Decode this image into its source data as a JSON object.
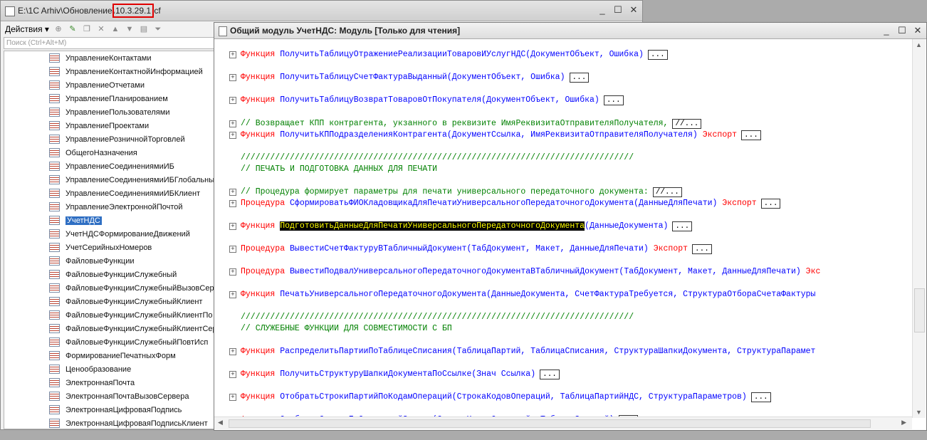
{
  "back_window": {
    "title_prefix": "E:\\1C Arhiv\\Обновление\\",
    "title_version": "10.3.29.1",
    "title_suffix": ".cf",
    "minimize": "_",
    "maximize": "☐",
    "close": "✕",
    "actions_label": "Действия ▾",
    "search_placeholder": "Поиск (Ctrl+Alt+M)",
    "tree_items": [
      "УправлениеКонтактами",
      "УправлениеКонтактнойИнформацией",
      "УправлениеОтчетами",
      "УправлениеПланированием",
      "УправлениеПользователями",
      "УправлениеПроектами",
      "УправлениеРозничнойТорговлей",
      "ОбщегоНазначения",
      "УправлениеСоединениямиИБ",
      "УправлениеСоединениямиИБГлобальный",
      "УправлениеСоединениямиИБКлиент",
      "УправлениеЭлектроннойПочтой",
      "УчетНДС",
      "УчетНДСФормированиеДвижений",
      "УчетСерийныхНомеров",
      "ФайловыеФункции",
      "ФайловыеФункцииСлужебный",
      "ФайловыеФункцииСлужебныйВызовСервера",
      "ФайловыеФункцииСлужебныйКлиент",
      "ФайловыеФункцииСлужебныйКлиентПо",
      "ФайловыеФункцииСлужебныйКлиентСервер",
      "ФайловыеФункцииСлужебныйПовтИсп",
      "ФормированиеПечатныхФорм",
      "Ценообразование",
      "ЭлектроннаяПочта",
      "ЭлектроннаяПочтаВызовСервера",
      "ЭлектроннаяЦифроваяПодпись",
      "ЭлектроннаяЦифроваяПодписьКлиент"
    ],
    "selected_item": "УчетНДС"
  },
  "module_window": {
    "title": "Общий модуль УчетНДС: Модуль [Только для чтения]",
    "minimize": "_",
    "maximize": "☐",
    "close": "✕",
    "lines": [
      {
        "kw": "Функция",
        "name": "ПолучитьТаблицуОтражениеРеализацииТоваровИУслугНДС",
        "args": "(ДокументОбъект, Ошибка)",
        "tail": "",
        "dots": "..."
      },
      {
        "kw": "Функция",
        "name": "ПолучитьТаблицуСчетФактураВыданный",
        "args": "(ДокументОбъект, Ошибка)",
        "tail": "",
        "dots": "..."
      },
      {
        "kw": "Функция",
        "name": "ПолучитьТаблицуВозвратТоваровОтПокупателя",
        "args": "(ДокументОбъект, Ошибка)",
        "tail": "",
        "dots": "..."
      },
      {
        "comment": "//  Возвращает КПП контрагента, укзанного в реквизите ИмяРеквизитаОтправителяПолучателя,",
        "dots": "//..."
      },
      {
        "kw": "Функция",
        "name": "ПолучитьКППодразделенияКонтрагента",
        "args": "(ДокументСсылка, ИмяРеквизитаОтправителяПолучателя)",
        "tail": " Экспорт",
        "dots": "..."
      },
      {
        "comment": "////////////////////////////////////////////////////////////////////////////////"
      },
      {
        "comment": "// ПЕЧАТЬ И ПОДГОТОВКА ДАННЫХ ДЛЯ ПЕЧАТИ"
      },
      {
        "comment": "// Процедура формирует параметры для печати универсального передаточного документа:",
        "dots": "//..."
      },
      {
        "kw": "Процедура",
        "name": "СформироватьФИОКладовщикаДляПечатиУниверсальногоПередаточногоДокумента",
        "args": "(ДанныеДляПечати)",
        "tail": " Экспорт",
        "dots": "..."
      },
      {
        "kw": "Функция",
        "name": "ПодготовитьДанныеДляПечатиУниверсальногоПередаточногоДокумента",
        "args": "(ДанныеДокумента)",
        "tail": "",
        "dots": "..."
      },
      {
        "kw": "Процедура",
        "name": "ВывестиСчетФактуруВТабличныйДокумент",
        "args": "(ТабДокумент, Макет, ДанныеДляПечати)",
        "tail": " Экспорт",
        "dots": "..."
      },
      {
        "kw": "Процедура",
        "name": "ВывестиПодвалУниверсальногоПередаточногоДокументаВТабличныйДокумент",
        "args": "(ТабДокумент, Макет, ДанныеДляПечати)",
        "tail": " Экс",
        "dots": ""
      },
      {
        "kw": "Функция",
        "name": "ПечатьУниверсальногоПередаточногоДокумента",
        "args": "(ДанныеДокумента, СчетФактураТребуется, СтруктураОтбораСчетаФактуры",
        "tail": "",
        "dots": ""
      },
      {
        "comment": "////////////////////////////////////////////////////////////////////////////////"
      },
      {
        "comment": "// СЛУЖЕБНЫЕ ФУНКЦИИ ДЛЯ СОВМЕСТИМОСТИ С БП"
      },
      {
        "kw": "Функция",
        "name": "РаспределитьПартииПоТаблицеСписания",
        "args": "(ТаблицаПартий, ТаблицаСписания, СтруктураШапкиДокумента, СтруктураПарамет",
        "tail": "",
        "dots": ""
      },
      {
        "kw": "Функция",
        "name": "ПолучитьСтруктуруШапкиДокументаПоСсылке",
        "args": "(Знач Ссылка)",
        "tail": "",
        "dots": "..."
      },
      {
        "kw": "Функция",
        "name": "ОтобратьСтрокиПартийПоКодамОпераций",
        "args": "(СтрокаКодовОпераций, ТаблицаПартийНДС, СтруктураПараметров)",
        "tail": "",
        "dots": "..."
      },
      {
        "kw": "Функция",
        "name": "ОтобратьСтрокиПоОтраженийЗаписи",
        "args": "(СтрокаКодовОпераций, ТаблицаЗаписей)",
        "tail": "",
        "dots": "..."
      }
    ]
  }
}
